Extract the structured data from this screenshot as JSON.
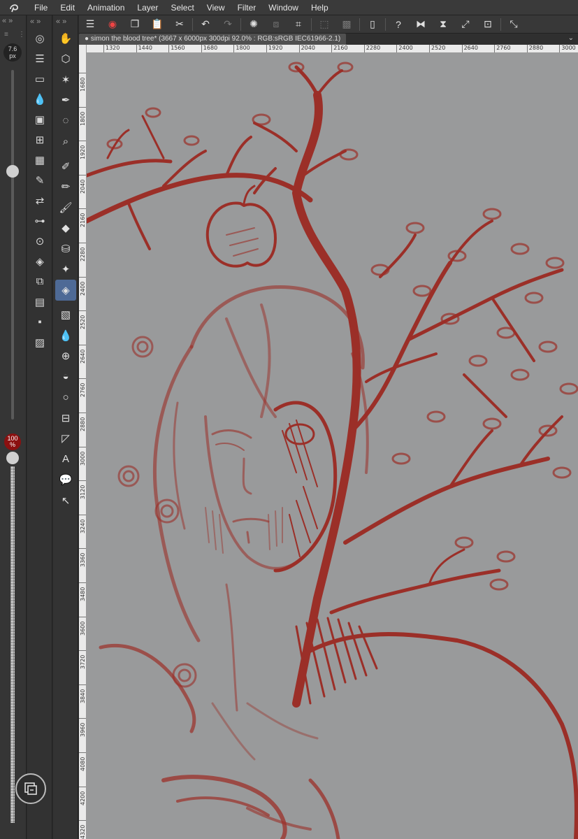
{
  "menubar": {
    "items": [
      "File",
      "Edit",
      "Animation",
      "Layer",
      "Select",
      "View",
      "Filter",
      "Window",
      "Help"
    ]
  },
  "left_strip": {
    "collapse_label": "«  »",
    "brush_size_value": "7.6",
    "brush_size_unit": "px",
    "brush_size_slider_level": 0.71,
    "opacity_value": "100",
    "opacity_unit": "%",
    "opacity_slider_level": 1.0
  },
  "panel_column": {
    "header": "« »",
    "icons": [
      "navigator-icon",
      "sub-tool-detail-icon",
      "layer-property-icon",
      "color-wheel-icon",
      "layer-icon",
      "material-icon",
      "color-set-icon",
      "brush-settings-icon",
      "history-icon",
      "adjust-icon",
      "search-layer-icon",
      "layers-stack-icon",
      "auto-action-icon",
      "canvas-icon",
      "save-icon",
      "image-icon"
    ]
  },
  "tools": {
    "header": "« »",
    "items": [
      "hand-icon",
      "rotate-icon",
      "magic-wand-icon",
      "eyedropper-icon",
      "lasso-icon",
      "zoom-icon",
      "pen-icon",
      "pencil-icon",
      "brush-icon",
      "marker-icon",
      "airbrush-icon",
      "sparkle-icon",
      "eraser-icon",
      "gradient-icon",
      "blend-icon",
      "grid-icon",
      "fill-icon",
      "circle-icon",
      "frame-icon",
      "ruler-icon",
      "text-icon",
      "balloon-icon",
      "correct-line-icon"
    ],
    "active": "eraser-icon"
  },
  "command_bar": {
    "items": [
      "menu-icon",
      "clip-studio-icon",
      "copy-icon",
      "paste-icon",
      "cut-icon",
      "undo-icon",
      "redo-icon",
      "loading-icon",
      "transform-icon",
      "crop-icon",
      "deselect-icon",
      "select-all-icon",
      "device-icon",
      "help-icon",
      "flip-h-icon",
      "flip-v-icon",
      "fit-icon",
      "crop-canvas-icon",
      "expand-icon"
    ]
  },
  "document": {
    "tab_title": "simon the blood tree* (3667 x 6000px 300dpi 92.0% : RGB:sRGB IEC61966-2.1)"
  },
  "rulers": {
    "horizontal": [
      "1320",
      "1440",
      "1560",
      "1680",
      "1800",
      "1920",
      "2040",
      "2160",
      "2280",
      "2400",
      "2520",
      "2640",
      "2760",
      "2880",
      "3000"
    ],
    "vertical": [
      "1680",
      "1800",
      "1920",
      "2040",
      "2160",
      "2280",
      "2400",
      "2520",
      "2640",
      "2760",
      "2880",
      "3000",
      "3120",
      "3240",
      "3360",
      "3480",
      "3600",
      "3720",
      "3840",
      "3960",
      "4080",
      "4200",
      "4320"
    ]
  },
  "colors": {
    "sketch_red": "#9c1c14",
    "canvas_gray": "#999a9b",
    "opacity_badge": "#8b1010",
    "active_tool": "#4e6a96"
  }
}
